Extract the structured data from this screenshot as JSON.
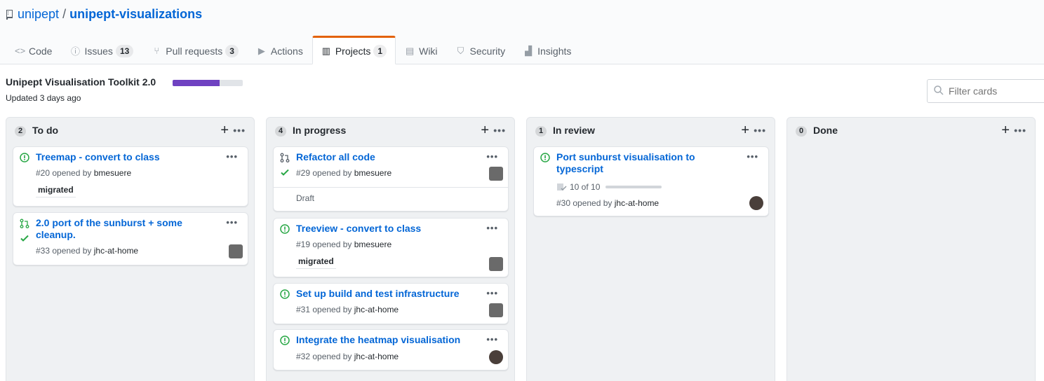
{
  "repo": {
    "owner": "unipept",
    "separator": "/",
    "name": "unipept-visualizations"
  },
  "tabs": [
    {
      "label": "Code",
      "icon": "code-icon"
    },
    {
      "label": "Issues",
      "icon": "issue-icon",
      "count": "13"
    },
    {
      "label": "Pull requests",
      "icon": "pull-request-icon",
      "count": "3"
    },
    {
      "label": "Actions",
      "icon": "play-icon"
    },
    {
      "label": "Projects",
      "icon": "project-icon",
      "count": "1",
      "selected": true
    },
    {
      "label": "Wiki",
      "icon": "book-icon"
    },
    {
      "label": "Security",
      "icon": "shield-icon"
    },
    {
      "label": "Insights",
      "icon": "graph-icon"
    }
  ],
  "project": {
    "title": "Unipept Visualisation Toolkit 2.0",
    "progress": 0.67,
    "updated": "Updated 3 days ago",
    "filter_placeholder": "Filter cards"
  },
  "colors": {
    "accent": "#0366d6",
    "progress": "#6f42c1",
    "open_issue": "#28a745",
    "selected_tab": "#e36209"
  },
  "columns": [
    {
      "count": "2",
      "name": "To do",
      "cards": [
        {
          "title": "Treemap - convert to class",
          "meta_prefix": "#20 opened by",
          "user": "bmesuere",
          "label": "migrated"
        },
        {
          "title": "2.0 port of the sunburst + some cleanup.",
          "meta_prefix": "#33 opened by",
          "user": "jhc-at-home"
        }
      ]
    },
    {
      "count": "4",
      "name": "In progress",
      "cards": [
        {
          "title": "Refactor all code",
          "meta_prefix": "#29 opened by",
          "user": "bmesuere",
          "note": "Draft"
        },
        {
          "title": "Treeview - convert to class",
          "meta_prefix": "#19 opened by",
          "user": "bmesuere",
          "label": "migrated"
        },
        {
          "title": "Set up build and test infrastructure",
          "meta_prefix": "#31 opened by",
          "user": "jhc-at-home"
        },
        {
          "title": "Integrate the heatmap visualisation",
          "meta_prefix": "#32 opened by",
          "user": "jhc-at-home"
        }
      ]
    },
    {
      "count": "1",
      "name": "In review",
      "cards": [
        {
          "title": "Port sunburst visualisation to typescript",
          "tasks": "10 of 10",
          "meta_prefix": "#30 opened by",
          "user": "jhc-at-home"
        }
      ]
    },
    {
      "count": "0",
      "name": "Done",
      "cards": []
    }
  ],
  "ui": {
    "add": "+",
    "menu": "•••"
  }
}
